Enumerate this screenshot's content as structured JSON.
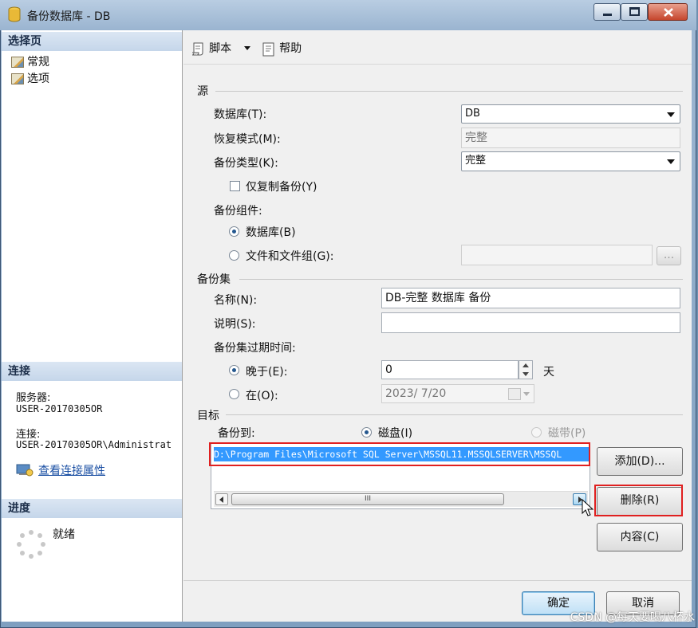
{
  "window": {
    "title": "备份数据库 - DB"
  },
  "left_pane": {
    "select_page_header": "选择页",
    "pages": [
      {
        "label": "常规"
      },
      {
        "label": "选项"
      }
    ],
    "connection": {
      "header": "连接",
      "server_label": "服务器:",
      "server_value": "USER-20170305OR",
      "connection_label": "连接:",
      "connection_value": "USER-20170305OR\\Administrat",
      "view_properties_link": "查看连接属性"
    },
    "progress": {
      "header": "进度",
      "status": "就绪"
    }
  },
  "toolbar": {
    "script_label": "脚本",
    "help_label": "帮助"
  },
  "source": {
    "group_title": "源",
    "database_label": "数据库(T):",
    "database_value": "DB",
    "recovery_model_label": "恢复模式(M):",
    "recovery_model_value": "完整",
    "backup_type_label": "备份类型(K):",
    "backup_type_value": "完整",
    "copy_only_label": "仅复制备份(Y)",
    "copy_only_checked": false,
    "component_label": "备份组件:",
    "component_database_label": "数据库(B)",
    "component_files_label": "文件和文件组(G):",
    "component_selected": "database",
    "browse_label": "..."
  },
  "backup_set": {
    "group_title": "备份集",
    "name_label": "名称(N):",
    "name_value": "DB-完整 数据库 备份",
    "description_label": "说明(S):",
    "description_value": "",
    "expire_label": "备份集过期时间:",
    "after_label": "晚于(E):",
    "after_value": "0",
    "after_unit": "天",
    "on_label": "在(O):",
    "on_value": "2023/ 7/20",
    "expire_selected": "after"
  },
  "destination": {
    "group_title": "目标",
    "backup_to_label": "备份到:",
    "disk_label": "磁盘(I)",
    "tape_label": "磁带(P)",
    "selected": "disk",
    "paths": [
      "D:\\Program Files\\Microsoft SQL Server\\MSSQL11.MSSQLSERVER\\MSSQL"
    ],
    "scroll_grip": "III",
    "add_label": "添加(D)...",
    "remove_label": "删除(R)",
    "contents_label": "内容(C)"
  },
  "footer": {
    "ok_label": "确定",
    "cancel_label": "取消"
  },
  "watermark": "CSDN @每天要喝八杯水",
  "colors": {
    "highlight": "#3399ff",
    "annotation_red": "#e02020",
    "section_header": "#c5d6ea"
  }
}
